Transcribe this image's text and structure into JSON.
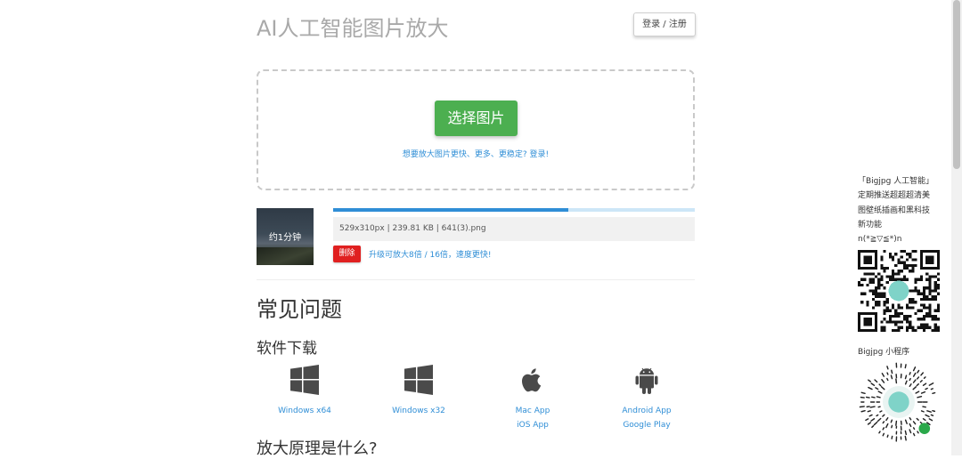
{
  "header": {
    "site_title": "AI人工智能图片放大",
    "login_label": "登录 / 注册"
  },
  "upload": {
    "select_button": "选择图片",
    "promo_text": "想要放大图片更快、更多、更稳定? 登录!"
  },
  "task": {
    "thumbnail_overlay": "约1分钟",
    "progress_fraction": 0.65,
    "file_info": "529x310px | 239.81 KB | 641(3).png",
    "delete_label": "删除",
    "upgrade_text": "升级可放大8倍 / 16倍，速度更快!"
  },
  "faq": {
    "heading": "常见问题",
    "download_heading": "软件下载",
    "downloads": [
      {
        "icon": "windows-icon",
        "links": [
          "Windows x64"
        ]
      },
      {
        "icon": "windows-icon",
        "links": [
          "Windows x32"
        ]
      },
      {
        "icon": "apple-icon",
        "links": [
          "Mac App",
          "iOS App"
        ]
      },
      {
        "icon": "android-icon",
        "links": [
          "Android App",
          "Google Play"
        ]
      }
    ],
    "principle_heading": "放大原理是什么?"
  },
  "sidebar": {
    "promo_text": "「Bigjpg 人工智能」\n定期推送超超超清美\n图壁纸插画和黑科技\n新功能\nn(*≧▽≦*)n",
    "mini_program_label": "Bigjpg 小程序"
  },
  "colors": {
    "accent_green": "#4caf50",
    "link_blue": "#2f8ed6",
    "delete_red": "#e02020"
  }
}
